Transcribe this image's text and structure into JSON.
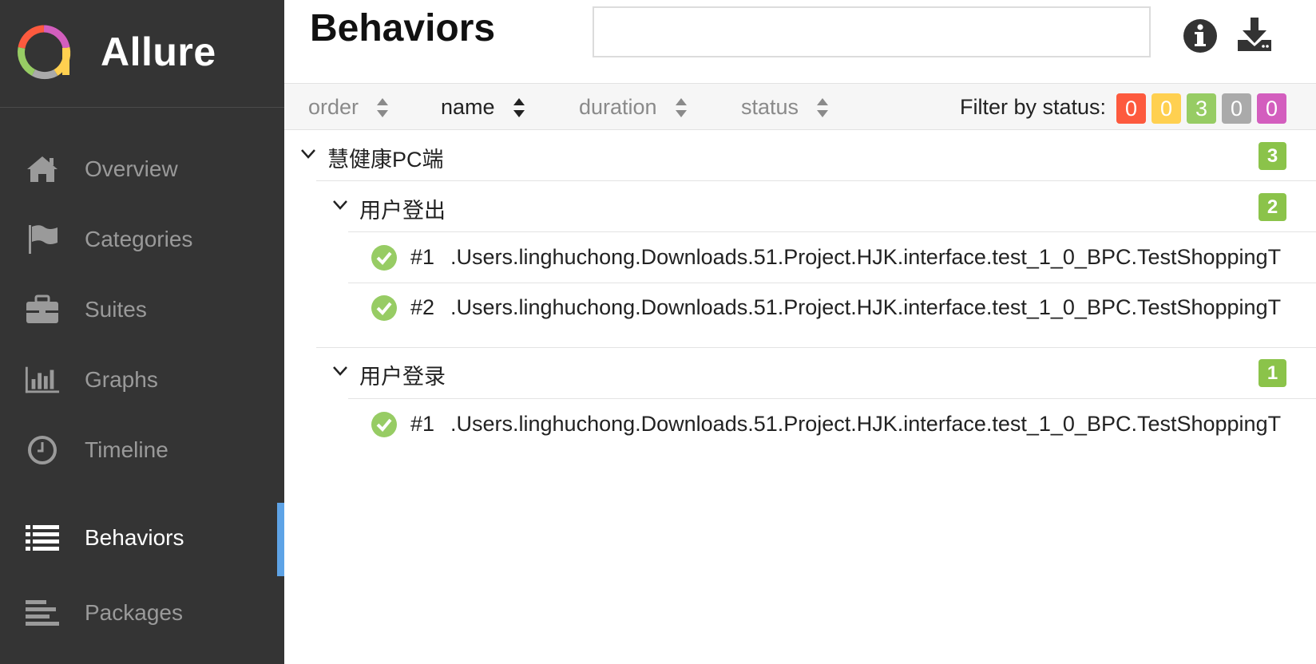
{
  "app": {
    "name": "Allure"
  },
  "sidebar": {
    "items": [
      {
        "label": "Overview",
        "icon": "home-icon",
        "active": false
      },
      {
        "label": "Categories",
        "icon": "flag-icon",
        "active": false
      },
      {
        "label": "Suites",
        "icon": "briefcase-icon",
        "active": false
      },
      {
        "label": "Graphs",
        "icon": "bar-chart-icon",
        "active": false
      },
      {
        "label": "Timeline",
        "icon": "clock-icon",
        "active": false
      },
      {
        "label": "Behaviors",
        "icon": "list-icon",
        "active": true
      },
      {
        "label": "Packages",
        "icon": "align-left-icon",
        "active": false
      }
    ]
  },
  "header": {
    "title": "Behaviors",
    "search_placeholder": "",
    "icons": [
      "info-icon",
      "download-icon"
    ]
  },
  "toolbar": {
    "sorts": [
      {
        "label": "order",
        "active": false
      },
      {
        "label": "name",
        "active": true
      },
      {
        "label": "duration",
        "active": false
      },
      {
        "label": "status",
        "active": false
      }
    ],
    "filter_label": "Filter by status:",
    "filters": [
      {
        "status": "failed",
        "count": "0",
        "color": "#fd5a3e"
      },
      {
        "status": "broken",
        "count": "0",
        "color": "#ffd050"
      },
      {
        "status": "passed",
        "count": "3",
        "color": "#97cc64"
      },
      {
        "status": "skipped",
        "count": "0",
        "color": "#aaaaaa"
      },
      {
        "status": "unknown",
        "count": "0",
        "color": "#d35ebe"
      }
    ]
  },
  "tree": {
    "epic": {
      "title": "慧健康PC端",
      "count": "3"
    },
    "features": [
      {
        "title": "用户登出",
        "count": "2",
        "tests": [
          {
            "num": "#1",
            "name": ".Users.linghuchong.Downloads.51.Project.HJK.interface.test_1_0_BPC.TestShoppingT",
            "status": "passed"
          },
          {
            "num": "#2",
            "name": ".Users.linghuchong.Downloads.51.Project.HJK.interface.test_1_0_BPC.TestShoppingT",
            "status": "passed"
          }
        ]
      },
      {
        "title": "用户登录",
        "count": "1",
        "tests": [
          {
            "num": "#1",
            "name": ".Users.linghuchong.Downloads.51.Project.HJK.interface.test_1_0_BPC.TestShoppingT",
            "status": "passed"
          }
        ]
      }
    ]
  },
  "colors": {
    "sidebar_bg": "#343434",
    "accent": "#5ea3e6",
    "passed": "#97cc64",
    "count_badge": "#8bc34a"
  }
}
